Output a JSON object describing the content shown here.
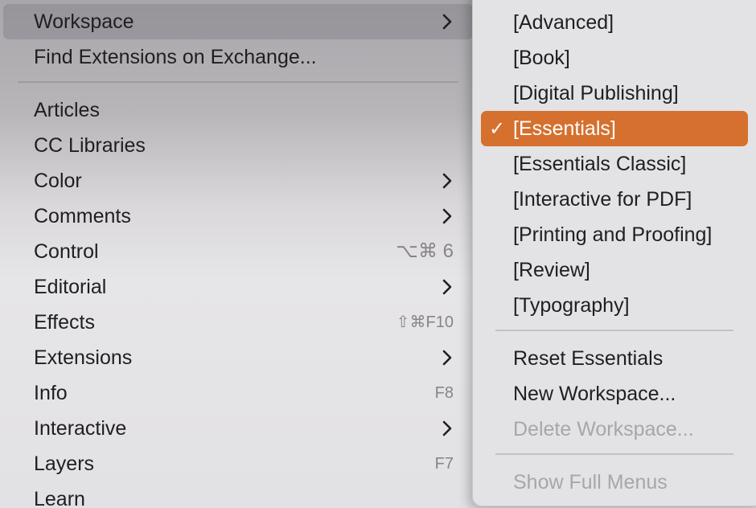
{
  "main_menu": {
    "workspace": {
      "label": "Workspace"
    },
    "find_extensions": {
      "label": "Find Extensions on Exchange..."
    },
    "items": [
      {
        "label": "Articles"
      },
      {
        "label": "CC Libraries"
      },
      {
        "label": "Color"
      },
      {
        "label": "Comments"
      },
      {
        "label": "Control",
        "shortcut": "⌥⌘ 6"
      },
      {
        "label": "Editorial"
      },
      {
        "label": "Effects",
        "shortcut": "⇧⌘F10"
      },
      {
        "label": "Extensions"
      },
      {
        "label": "Info",
        "shortcut": "F8"
      },
      {
        "label": "Interactive"
      },
      {
        "label": "Layers",
        "shortcut": "F7"
      },
      {
        "label": "Learn"
      }
    ]
  },
  "workspace_submenu": {
    "check_mark": "✓",
    "workspaces": [
      {
        "label": "[Advanced]"
      },
      {
        "label": "[Book]"
      },
      {
        "label": "[Digital Publishing]"
      },
      {
        "label": "[Essentials]",
        "checked": true
      },
      {
        "label": "[Essentials Classic]"
      },
      {
        "label": "[Interactive for PDF]"
      },
      {
        "label": "[Printing and Proofing]"
      },
      {
        "label": "[Review]"
      },
      {
        "label": "[Typography]"
      }
    ],
    "reset": {
      "label": "Reset Essentials"
    },
    "new_workspace": {
      "label": "New Workspace..."
    },
    "delete_workspace": {
      "label": "Delete Workspace...",
      "enabled": false
    },
    "show_full_menus": {
      "label": "Show Full Menus",
      "enabled": false
    }
  },
  "colors": {
    "selection": "#d5702e",
    "hover": "#8a868f",
    "text": "#1f1e21",
    "disabled_text": "#a8a6aa"
  }
}
